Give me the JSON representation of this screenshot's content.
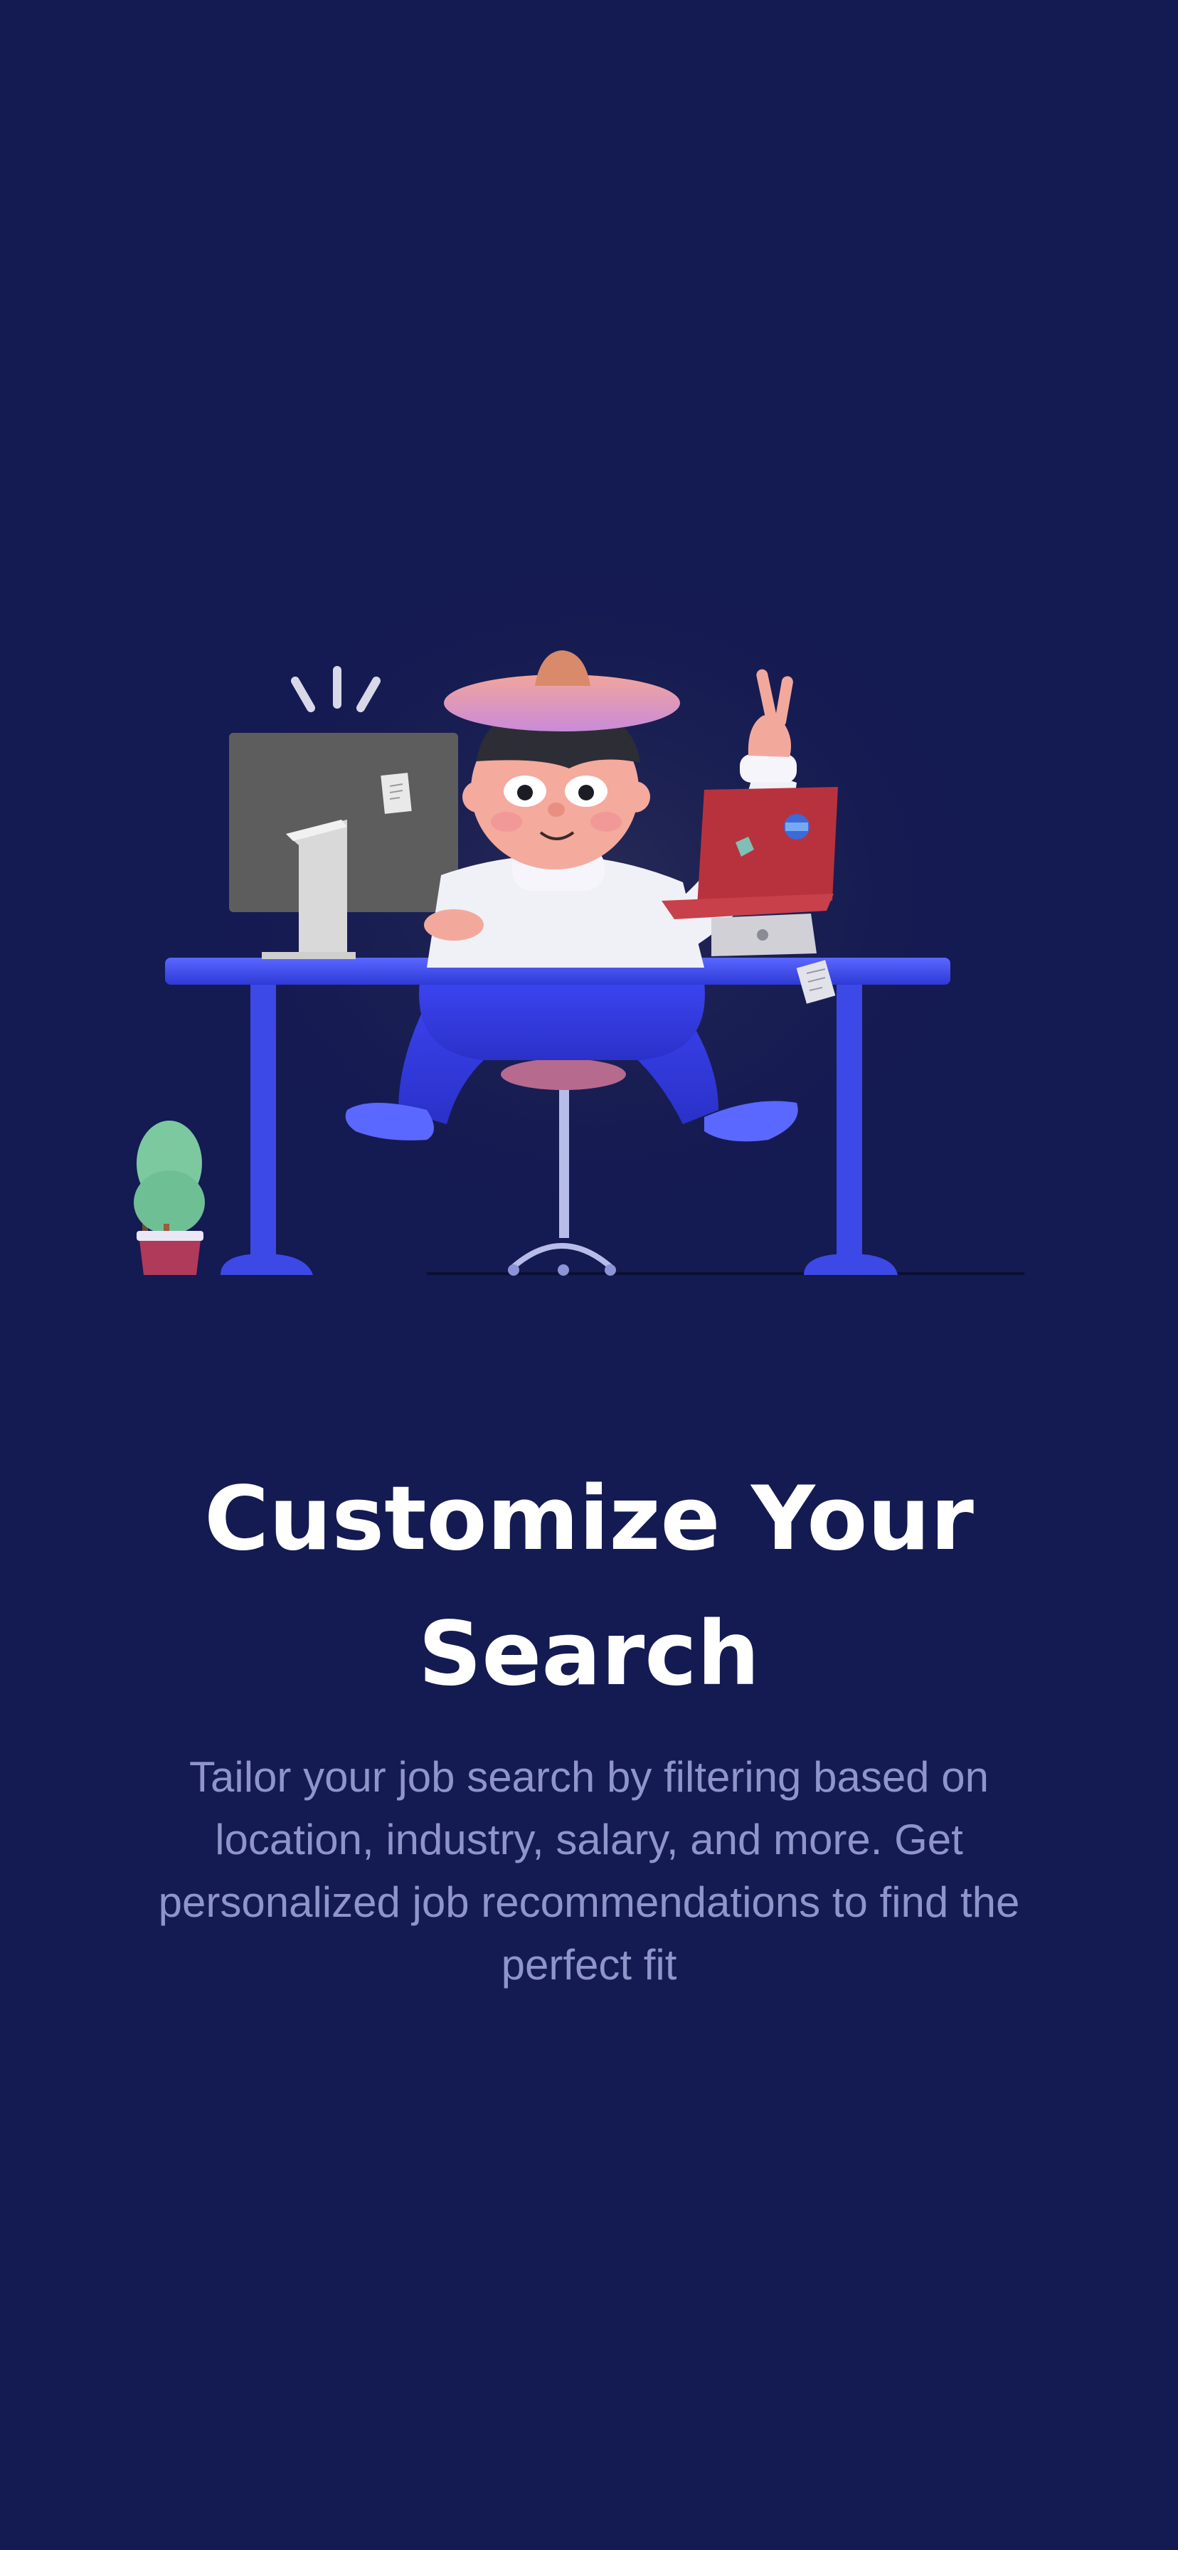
{
  "onboarding": {
    "title": "Customize Your Search",
    "description": "Tailor your job search by filtering based on location, industry, salary, and more. Get personalized job recommendations to find the perfect fit"
  },
  "illustration": {
    "subject": "person-celebrating-at-desk",
    "elements": [
      "desktop-monitor",
      "laptop",
      "desk",
      "office-chair",
      "potted-plant",
      "sticky-note"
    ]
  },
  "colors": {
    "background": "#141a52",
    "title": "#ffffff",
    "description": "#8e95c9",
    "desk_accent": "#3f4fe0",
    "laptop": "#b8323e"
  }
}
